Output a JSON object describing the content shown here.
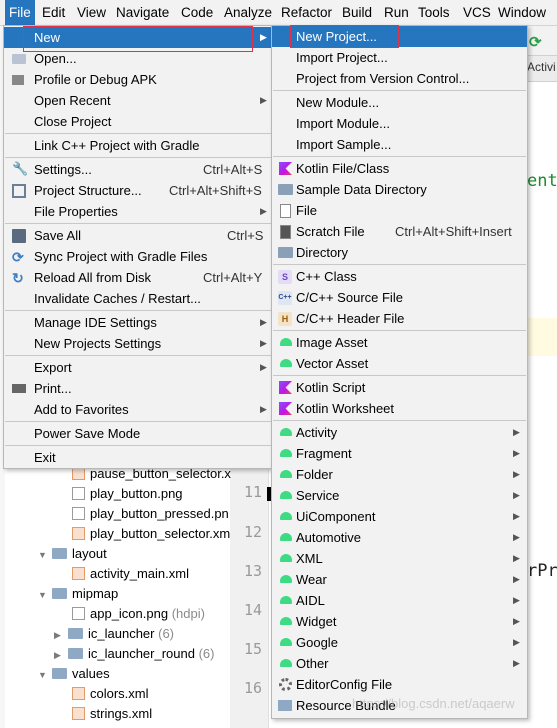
{
  "menubar": {
    "items": [
      "File",
      "Edit",
      "View",
      "Navigate",
      "Code",
      "Analyze",
      "Refactor",
      "Build",
      "Run",
      "Tools",
      "VCS",
      "Window"
    ]
  },
  "ide": {
    "right_fragments": [
      "ent",
      "rPr"
    ],
    "right_tab_label": "Activi",
    "line_numbers": [
      "11",
      "12",
      "13",
      "14",
      "15",
      "16"
    ]
  },
  "tree": {
    "items": [
      {
        "label": "pause_button_selector.x",
        "suffix": ""
      },
      {
        "label": "play_button.png",
        "suffix": ""
      },
      {
        "label": "play_button_pressed.pn",
        "suffix": ""
      },
      {
        "label": "play_button_selector.xm",
        "suffix": ""
      },
      {
        "label": "layout",
        "suffix": ""
      },
      {
        "label": "activity_main.xml",
        "suffix": ""
      },
      {
        "label": "mipmap",
        "suffix": ""
      },
      {
        "label": "app_icon.png",
        "suffix": " (hdpi)"
      },
      {
        "label": "ic_launcher",
        "suffix": " (6)"
      },
      {
        "label": "ic_launcher_round",
        "suffix": " (6)"
      },
      {
        "label": "values",
        "suffix": ""
      },
      {
        "label": "colors.xml",
        "suffix": ""
      },
      {
        "label": "strings.xml",
        "suffix": ""
      }
    ]
  },
  "file_menu": {
    "items": [
      {
        "label": "New",
        "shortcut": "",
        "submenu": true,
        "icon": ""
      },
      {
        "label": "Open...",
        "shortcut": "",
        "submenu": false,
        "icon": "folder-open-icon"
      },
      {
        "label": "Profile or Debug APK",
        "shortcut": "",
        "submenu": false,
        "icon": "apk-icon"
      },
      {
        "label": "Open Recent",
        "shortcut": "",
        "submenu": true,
        "icon": ""
      },
      {
        "label": "Close Project",
        "shortcut": "",
        "submenu": false,
        "icon": ""
      },
      {
        "label": "Link C++ Project with Gradle",
        "shortcut": "",
        "submenu": false,
        "icon": ""
      },
      {
        "label": "Settings...",
        "shortcut": "Ctrl+Alt+S",
        "submenu": false,
        "icon": "wrench-icon"
      },
      {
        "label": "Project Structure...",
        "shortcut": "Ctrl+Alt+Shift+S",
        "submenu": false,
        "icon": "project-structure-icon"
      },
      {
        "label": "File Properties",
        "shortcut": "",
        "submenu": true,
        "icon": ""
      },
      {
        "label": "Save All",
        "shortcut": "Ctrl+S",
        "submenu": false,
        "icon": "save-icon"
      },
      {
        "label": "Sync Project with Gradle Files",
        "shortcut": "",
        "submenu": false,
        "icon": "gradle-sync-icon"
      },
      {
        "label": "Reload All from Disk",
        "shortcut": "Ctrl+Alt+Y",
        "submenu": false,
        "icon": "reload-icon"
      },
      {
        "label": "Invalidate Caches / Restart...",
        "shortcut": "",
        "submenu": false,
        "icon": ""
      },
      {
        "label": "Manage IDE Settings",
        "shortcut": "",
        "submenu": true,
        "icon": ""
      },
      {
        "label": "New Projects Settings",
        "shortcut": "",
        "submenu": true,
        "icon": ""
      },
      {
        "label": "Export",
        "shortcut": "",
        "submenu": true,
        "icon": ""
      },
      {
        "label": "Print...",
        "shortcut": "",
        "submenu": false,
        "icon": "print-icon"
      },
      {
        "label": "Add to Favorites",
        "shortcut": "",
        "submenu": true,
        "icon": ""
      },
      {
        "label": "Power Save Mode",
        "shortcut": "",
        "submenu": false,
        "icon": ""
      },
      {
        "label": "Exit",
        "shortcut": "",
        "submenu": false,
        "icon": ""
      }
    ]
  },
  "new_menu": {
    "items": [
      {
        "label": "New Project...",
        "shortcut": "",
        "submenu": false,
        "icon": ""
      },
      {
        "label": "Import Project...",
        "shortcut": "",
        "submenu": false,
        "icon": ""
      },
      {
        "label": "Project from Version Control...",
        "shortcut": "",
        "submenu": false,
        "icon": ""
      },
      {
        "label": "New Module...",
        "shortcut": "",
        "submenu": false,
        "icon": ""
      },
      {
        "label": "Import Module...",
        "shortcut": "",
        "submenu": false,
        "icon": ""
      },
      {
        "label": "Import Sample...",
        "shortcut": "",
        "submenu": false,
        "icon": ""
      },
      {
        "label": "Kotlin File/Class",
        "shortcut": "",
        "submenu": false,
        "icon": "kotlin-icon"
      },
      {
        "label": "Sample Data Directory",
        "shortcut": "",
        "submenu": false,
        "icon": "folder-icon"
      },
      {
        "label": "File",
        "shortcut": "",
        "submenu": false,
        "icon": "file-icon"
      },
      {
        "label": "Scratch File",
        "shortcut": "Ctrl+Alt+Shift+Insert",
        "submenu": false,
        "icon": "scratch-file-icon"
      },
      {
        "label": "Directory",
        "shortcut": "",
        "submenu": false,
        "icon": "folder-icon"
      },
      {
        "label": "C++ Class",
        "shortcut": "",
        "submenu": false,
        "icon": "cpp-class-icon"
      },
      {
        "label": "C/C++ Source File",
        "shortcut": "",
        "submenu": false,
        "icon": "cpp-source-icon"
      },
      {
        "label": "C/C++ Header File",
        "shortcut": "",
        "submenu": false,
        "icon": "cpp-header-icon"
      },
      {
        "label": "Image Asset",
        "shortcut": "",
        "submenu": false,
        "icon": "android-icon"
      },
      {
        "label": "Vector Asset",
        "shortcut": "",
        "submenu": false,
        "icon": "android-icon"
      },
      {
        "label": "Kotlin Script",
        "shortcut": "",
        "submenu": false,
        "icon": "kotlin-icon"
      },
      {
        "label": "Kotlin Worksheet",
        "shortcut": "",
        "submenu": false,
        "icon": "kotlin-icon"
      },
      {
        "label": "Activity",
        "shortcut": "",
        "submenu": true,
        "icon": "android-icon"
      },
      {
        "label": "Fragment",
        "shortcut": "",
        "submenu": true,
        "icon": "android-icon"
      },
      {
        "label": "Folder",
        "shortcut": "",
        "submenu": true,
        "icon": "android-icon"
      },
      {
        "label": "Service",
        "shortcut": "",
        "submenu": true,
        "icon": "android-icon"
      },
      {
        "label": "UiComponent",
        "shortcut": "",
        "submenu": true,
        "icon": "android-icon"
      },
      {
        "label": "Automotive",
        "shortcut": "",
        "submenu": true,
        "icon": "android-icon"
      },
      {
        "label": "XML",
        "shortcut": "",
        "submenu": true,
        "icon": "android-icon"
      },
      {
        "label": "Wear",
        "shortcut": "",
        "submenu": true,
        "icon": "android-icon"
      },
      {
        "label": "AIDL",
        "shortcut": "",
        "submenu": true,
        "icon": "android-icon"
      },
      {
        "label": "Widget",
        "shortcut": "",
        "submenu": true,
        "icon": "android-icon"
      },
      {
        "label": "Google",
        "shortcut": "",
        "submenu": true,
        "icon": "android-icon"
      },
      {
        "label": "Other",
        "shortcut": "",
        "submenu": true,
        "icon": "android-icon"
      },
      {
        "label": "EditorConfig File",
        "shortcut": "",
        "submenu": false,
        "icon": "gear-icon"
      },
      {
        "label": "Resource Bundle",
        "shortcut": "",
        "submenu": false,
        "icon": "resource-bundle-icon"
      }
    ]
  },
  "watermark": "https://blog.csdn.net/aqaerw",
  "colors": {
    "highlight": "#2675bf",
    "menu_bg": "#f2f2f2",
    "red_outline": "#e0334b",
    "android_green": "#3ddc84"
  }
}
